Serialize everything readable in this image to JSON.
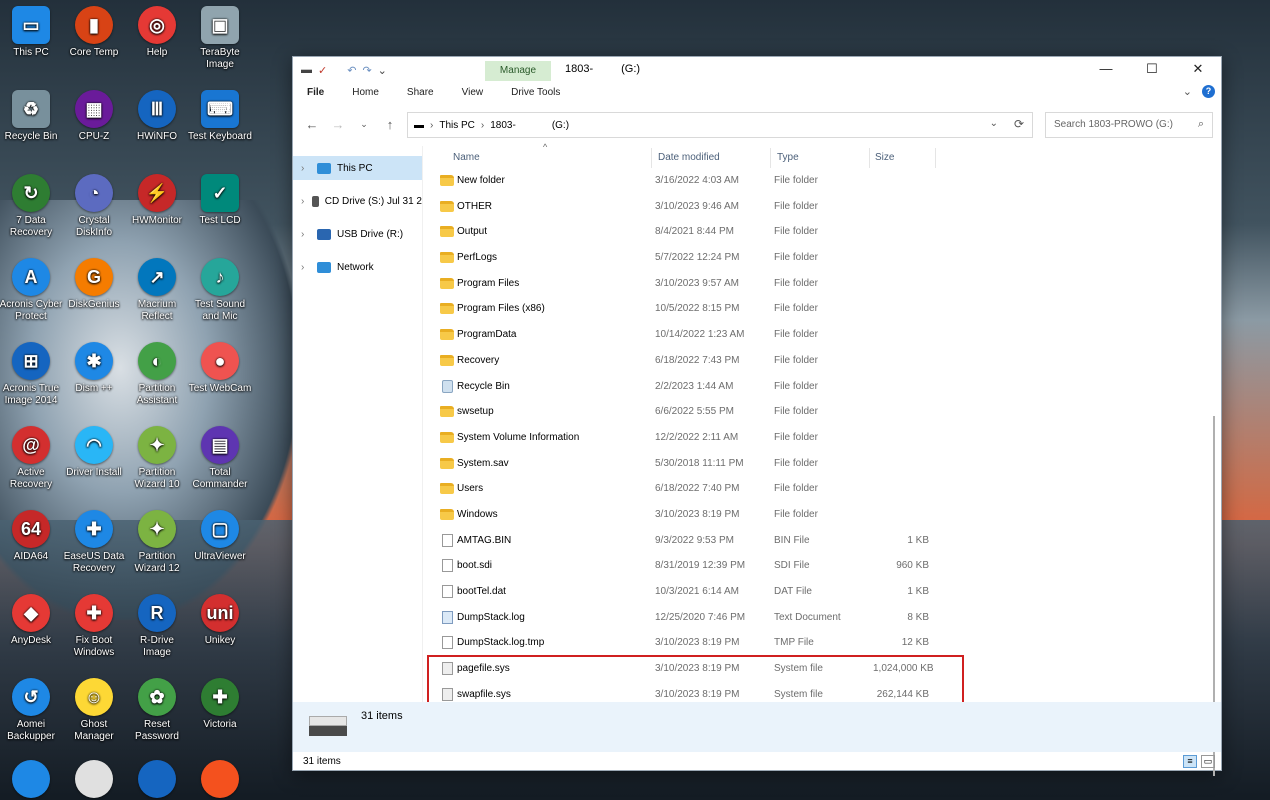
{
  "desktop": {
    "icons": [
      {
        "label": "This PC",
        "color": "#1e88e5"
      },
      {
        "label": "Core Temp",
        "color": "#d84315"
      },
      {
        "label": "Help",
        "color": "#e53935"
      },
      {
        "label": "TeraByte Image",
        "color": "#90a4ae"
      },
      {
        "label": "Recycle Bin",
        "color": "#78909c"
      },
      {
        "label": "CPU-Z",
        "color": "#6a1b9a"
      },
      {
        "label": "HWiNFO",
        "color": "#1565c0"
      },
      {
        "label": "Test Keyboard",
        "color": "#1976d2"
      },
      {
        "label": "7 Data Recovery",
        "color": "#2e7d32"
      },
      {
        "label": "Crystal DiskInfo",
        "color": "#5c6bc0"
      },
      {
        "label": "HWMonitor",
        "color": "#c62828"
      },
      {
        "label": "Test LCD",
        "color": "#00897b"
      },
      {
        "label": "Acronis Cyber Protect",
        "color": "#1e88e5"
      },
      {
        "label": "DiskGenius",
        "color": "#f57c00"
      },
      {
        "label": "Macrium Reflect",
        "color": "#0277bd"
      },
      {
        "label": "Test Sound and Mic",
        "color": "#26a69a"
      },
      {
        "label": "Acronis True Image 2014",
        "color": "#1565c0"
      },
      {
        "label": "Dism ++",
        "color": "#1e88e5"
      },
      {
        "label": "Partition Assistant",
        "color": "#43a047"
      },
      {
        "label": "Test WebCam",
        "color": "#ef5350"
      },
      {
        "label": "Active Recovery",
        "color": "#d32f2f"
      },
      {
        "label": "Driver Install",
        "color": "#29b6f6"
      },
      {
        "label": "Partition Wizard 10",
        "color": "#7cb342"
      },
      {
        "label": "Total Commander",
        "color": "#5e35b1"
      },
      {
        "label": "AIDA64",
        "color": "#c62828"
      },
      {
        "label": "EaseUS Data Recovery",
        "color": "#1e88e5"
      },
      {
        "label": "Partition Wizard 12",
        "color": "#7cb342"
      },
      {
        "label": "UltraViewer",
        "color": "#1e88e5"
      },
      {
        "label": "AnyDesk",
        "color": "#e53935"
      },
      {
        "label": "Fix Boot Windows",
        "color": "#e53935"
      },
      {
        "label": "R-Drive Image",
        "color": "#1565c0"
      },
      {
        "label": "Unikey",
        "color": "#d32f2f"
      },
      {
        "label": "Aomei Backupper",
        "color": "#1e88e5"
      },
      {
        "label": "Ghost Manager",
        "color": "#fdd835"
      },
      {
        "label": "Reset Password",
        "color": "#43a047"
      },
      {
        "label": "Victoria",
        "color": "#2e7d32"
      }
    ]
  },
  "window": {
    "manage_tab": "Manage",
    "title_prefix": "1803-",
    "title_suffix": "(G:)",
    "ribbon_tabs": [
      "File",
      "Home",
      "Share",
      "View",
      "Drive Tools"
    ],
    "help_label": "?",
    "address": {
      "root": "This PC",
      "drive_prefix": "1803-",
      "drive_suffix": "(G:)"
    },
    "search_placeholder": "Search 1803-PROWO (G:)",
    "nav_items": [
      {
        "label": "This PC",
        "selected": true,
        "color": "#2f8ed8"
      },
      {
        "label": "CD Drive (S:) Jul 31 2",
        "selected": false,
        "color": "#555555"
      },
      {
        "label": "USB Drive (R:)",
        "selected": false,
        "color": "#2a66b0"
      },
      {
        "label": "Network",
        "selected": false,
        "color": "#2f8ed8"
      }
    ],
    "columns": {
      "name": "Name",
      "date": "Date modified",
      "type": "Type",
      "size": "Size"
    },
    "files": [
      {
        "name": "New folder",
        "date": "3/16/2022 4:03 AM",
        "type": "File folder",
        "size": "",
        "icon": "folder"
      },
      {
        "name": "OTHER",
        "date": "3/10/2023 9:46 AM",
        "type": "File folder",
        "size": "",
        "icon": "folder"
      },
      {
        "name": "Output",
        "date": "8/4/2021 8:44 PM",
        "type": "File folder",
        "size": "",
        "icon": "folder"
      },
      {
        "name": "PerfLogs",
        "date": "5/7/2022 12:24 PM",
        "type": "File folder",
        "size": "",
        "icon": "folder"
      },
      {
        "name": "Program Files",
        "date": "3/10/2023 9:57 AM",
        "type": "File folder",
        "size": "",
        "icon": "folder"
      },
      {
        "name": "Program Files (x86)",
        "date": "10/5/2022 8:15 PM",
        "type": "File folder",
        "size": "",
        "icon": "folder"
      },
      {
        "name": "ProgramData",
        "date": "10/14/2022 1:23 AM",
        "type": "File folder",
        "size": "",
        "icon": "folder"
      },
      {
        "name": "Recovery",
        "date": "6/18/2022 7:43 PM",
        "type": "File folder",
        "size": "",
        "icon": "folder"
      },
      {
        "name": "Recycle Bin",
        "date": "2/2/2023 1:44 AM",
        "type": "File folder",
        "size": "",
        "icon": "binicon"
      },
      {
        "name": "swsetup",
        "date": "6/6/2022 5:55 PM",
        "type": "File folder",
        "size": "",
        "icon": "folder"
      },
      {
        "name": "System Volume Information",
        "date": "12/2/2022 2:11 AM",
        "type": "File folder",
        "size": "",
        "icon": "folder"
      },
      {
        "name": "System.sav",
        "date": "5/30/2018 11:11 PM",
        "type": "File folder",
        "size": "",
        "icon": "folder"
      },
      {
        "name": "Users",
        "date": "6/18/2022 7:40 PM",
        "type": "File folder",
        "size": "",
        "icon": "folder"
      },
      {
        "name": "Windows",
        "date": "3/10/2023 8:19 PM",
        "type": "File folder",
        "size": "",
        "icon": "folder"
      },
      {
        "name": "AMTAG.BIN",
        "date": "9/3/2022 9:53 PM",
        "type": "BIN File",
        "size": "1 KB",
        "icon": "doc"
      },
      {
        "name": "boot.sdi",
        "date": "8/31/2019 12:39 PM",
        "type": "SDI File",
        "size": "960 KB",
        "icon": "doc"
      },
      {
        "name": "bootTel.dat",
        "date": "10/3/2021 6:14 AM",
        "type": "DAT File",
        "size": "1 KB",
        "icon": "doc"
      },
      {
        "name": "DumpStack.log",
        "date": "12/25/2020 7:46 PM",
        "type": "Text Document",
        "size": "8 KB",
        "icon": "logdoc"
      },
      {
        "name": "DumpStack.log.tmp",
        "date": "3/10/2023 8:19 PM",
        "type": "TMP File",
        "size": "12 KB",
        "icon": "doc"
      },
      {
        "name": "pagefile.sys",
        "date": "3/10/2023 8:19 PM",
        "type": "System file",
        "size": "1,024,000 KB",
        "icon": "sysdoc"
      },
      {
        "name": "swapfile.sys",
        "date": "3/10/2023 8:19 PM",
        "type": "System file",
        "size": "262,144 KB",
        "icon": "sysdoc"
      }
    ],
    "status_items": "31 items",
    "footer_items": "31 items"
  }
}
